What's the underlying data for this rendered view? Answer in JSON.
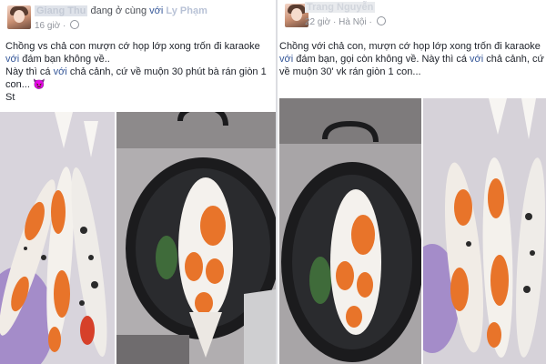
{
  "left_post": {
    "author": "Giang Thu",
    "action_text": "đang ở cùng",
    "with_word": "với",
    "tagged_name": "Ly Phạm",
    "time": "16 giờ",
    "caption_line1_a": "Chồng vs chả con mượn cớ họp lớp xong trốn đi karaoke",
    "caption_line1_link": "với",
    "caption_line1_b": "đám bạn không về..",
    "caption_line2_a": "Này thì cá",
    "caption_line2_link1": "với",
    "caption_line2_b": "chả cảnh, cứ về muộn 30 phút bà rán giòn 1 con...",
    "caption_emoji": "👿",
    "caption_line3": "St"
  },
  "right_post": {
    "author": "Trang Nguyễn",
    "time": "22 giờ",
    "location": "Hà Nội",
    "caption_line1_a": "Chồng với chả con, mượn cớ họp lớp xong trốn đi karaoke",
    "caption_line1_link": "với",
    "caption_line1_b": "đám bạn, gọi còn không về. Này thì cá",
    "caption_line1_link2": "với",
    "caption_line1_c": "chả cảnh, cứ về muộn 30' vk rán giòn 1 con..."
  },
  "colors": {
    "link": "#365899",
    "text": "#1d2129",
    "meta": "#90949c",
    "koi_orange": "#e8742a",
    "pan_black": "#1b1b1d"
  },
  "icons": {
    "privacy": "globe-icon"
  }
}
